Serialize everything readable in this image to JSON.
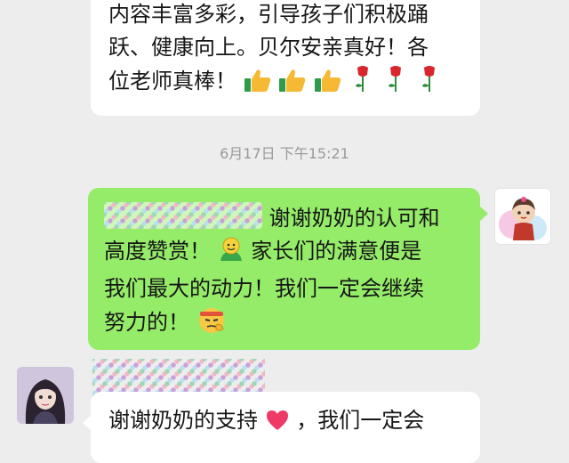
{
  "messages": {
    "top": {
      "line1": "内容丰富多彩，引导孩子们积极踊",
      "line2": "跃、健康向上。贝尔安亲真好！各",
      "line3": "位老师真棒！"
    },
    "timestamp": "6月17日 下午15:21",
    "reply": {
      "line1": "谢谢奶奶的认可和",
      "line2a": "高度赞赏！",
      "line2b": "家长们的满意便是",
      "line3": "我们最大的动力！我们一定会继续",
      "line4": "努力的！"
    },
    "bottom": {
      "line1a": "谢谢奶奶的支持",
      "line1b": "，我们一定会"
    }
  },
  "colors": {
    "background": "#ededed",
    "bubble_self": "#95ec69",
    "bubble_other": "#ffffff",
    "timestamp": "#9a9a9a"
  },
  "icons": [
    "thumbs-up-icon",
    "rose-icon",
    "smiley-icon",
    "determined-face-icon",
    "heart-icon"
  ]
}
